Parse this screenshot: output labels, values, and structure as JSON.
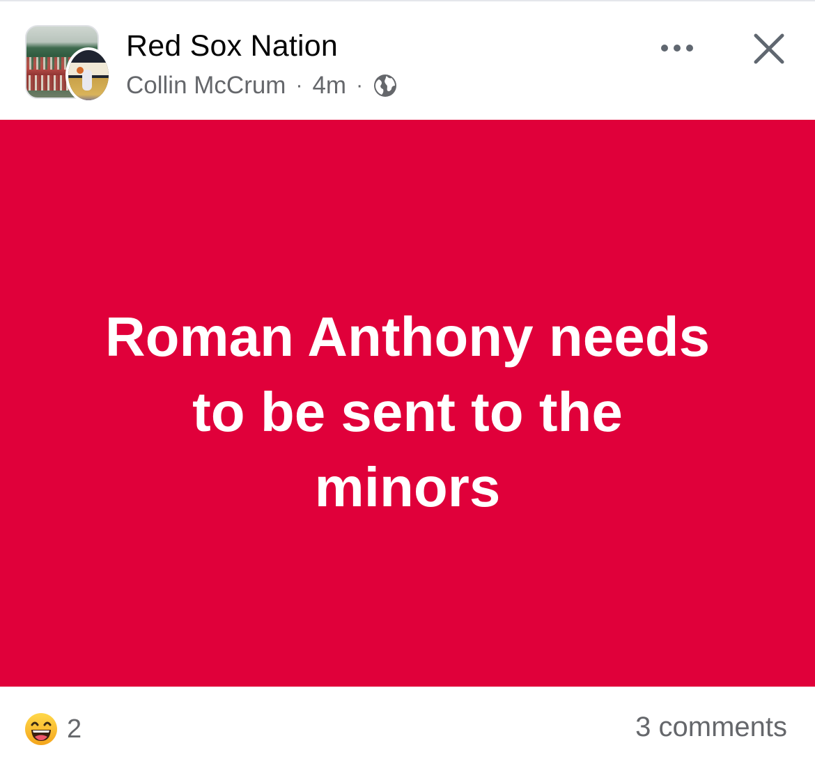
{
  "post": {
    "group_name": "Red Sox Nation",
    "author": "Collin McCrum",
    "separator": "·",
    "time": "4m",
    "privacy_icon": "globe-icon",
    "more_icon": "ellipsis-icon",
    "close_icon": "close-icon",
    "background_color": "#e0003a",
    "text": "Roman Anthony needs to be sent to the minors"
  },
  "footer": {
    "reaction_icon": "haha-emoji-icon",
    "reaction_count": "2",
    "comments": "3 comments"
  },
  "colors": {
    "post_background": "#e0003a",
    "secondary_text": "#65676b",
    "primary_text": "#050505"
  }
}
